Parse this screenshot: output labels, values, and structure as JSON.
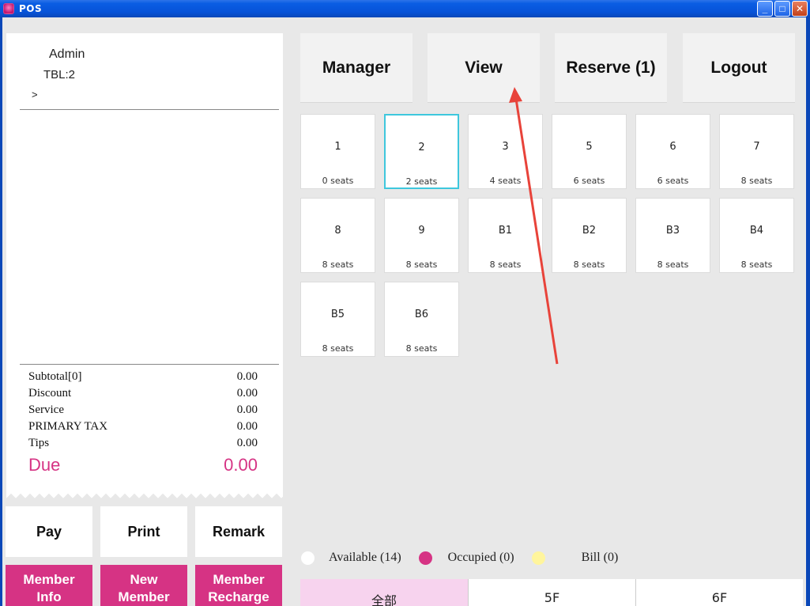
{
  "window": {
    "title": "POS"
  },
  "receipt": {
    "user": "Admin",
    "table": "TBL:2",
    "cursor": ">",
    "totals": [
      {
        "label": "Subtotal[0]",
        "value": "0.00"
      },
      {
        "label": "Discount",
        "value": "0.00"
      },
      {
        "label": "Service",
        "value": "0.00"
      },
      {
        "label": "PRIMARY TAX",
        "value": "0.00"
      },
      {
        "label": "Tips",
        "value": "0.00"
      }
    ],
    "due_label": "Due",
    "due_value": "0.00"
  },
  "actions": {
    "pay": "Pay",
    "print": "Print",
    "remark": "Remark"
  },
  "member": {
    "info_line1": "Member",
    "info_line2": "Info",
    "new_line1": "New",
    "new_line2": "Member",
    "recharge_line1": "Member",
    "recharge_line2": "Recharge"
  },
  "nav": {
    "manager": "Manager",
    "view": "View",
    "reserve": "Reserve (1)",
    "logout": "Logout"
  },
  "tables": [
    {
      "name": "1",
      "seats": "0 seats"
    },
    {
      "name": "2",
      "seats": "2 seats",
      "selected": true
    },
    {
      "name": "3",
      "seats": "4 seats"
    },
    {
      "name": "5",
      "seats": "6 seats"
    },
    {
      "name": "6",
      "seats": "6 seats"
    },
    {
      "name": "7",
      "seats": "8 seats"
    },
    {
      "name": "8",
      "seats": "8 seats"
    },
    {
      "name": "9",
      "seats": "8 seats"
    },
    {
      "name": "B1",
      "seats": "8 seats"
    },
    {
      "name": "B2",
      "seats": "8 seats"
    },
    {
      "name": "B3",
      "seats": "8 seats"
    },
    {
      "name": "B4",
      "seats": "8 seats"
    },
    {
      "name": "B5",
      "seats": "8 seats"
    },
    {
      "name": "B6",
      "seats": "8 seats"
    }
  ],
  "legend": {
    "available": "Available (14)",
    "occupied": "Occupied (0)",
    "bill": "Bill (0)"
  },
  "floors": [
    "全部",
    "5F",
    "6F"
  ],
  "colors": {
    "accent": "#d63384",
    "selected_border": "#3ec7dd",
    "bill": "#fff59d",
    "annotation": "#e8433a"
  }
}
